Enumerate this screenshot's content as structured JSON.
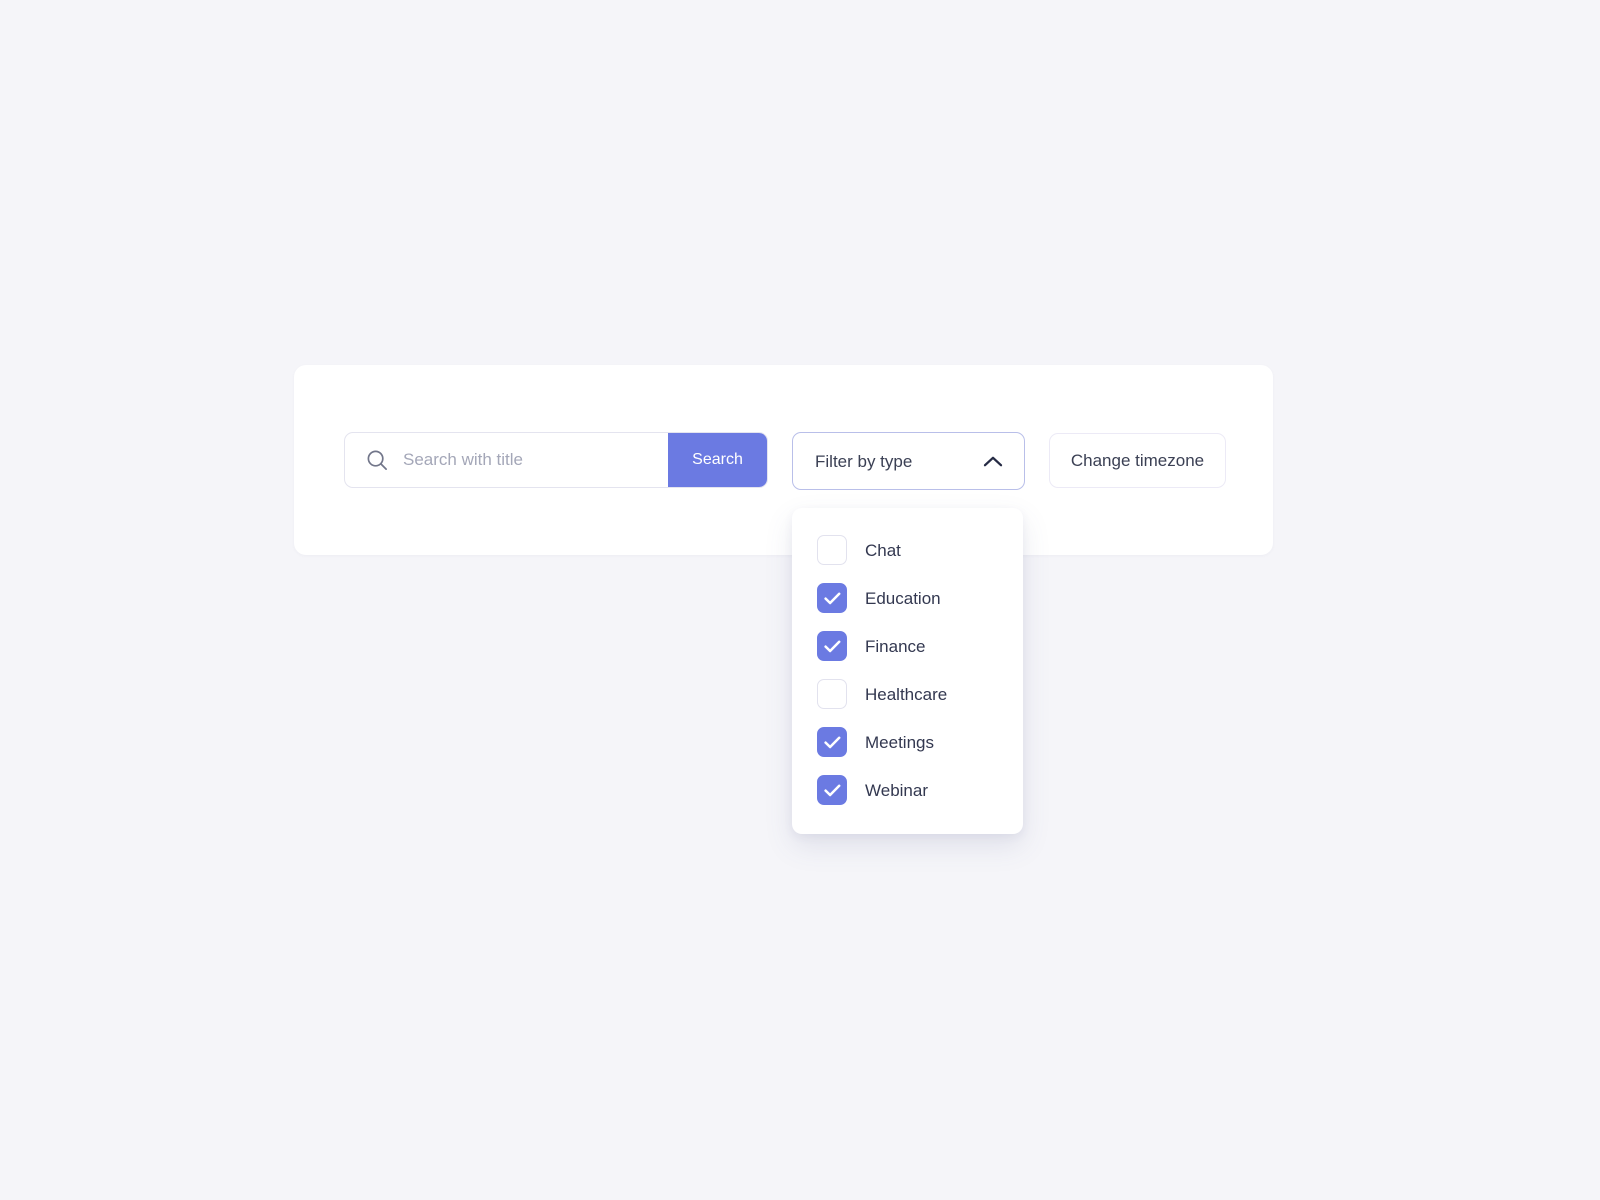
{
  "search": {
    "icon": "search-icon",
    "value": "",
    "placeholder": "Search with title",
    "button_label": "Search"
  },
  "filter": {
    "label": "Filter by type",
    "chevron_icon": "chevron-up-icon",
    "expanded": true,
    "options": [
      {
        "label": "Chat",
        "checked": false
      },
      {
        "label": "Education",
        "checked": true
      },
      {
        "label": "Finance",
        "checked": true
      },
      {
        "label": "Healthcare",
        "checked": false
      },
      {
        "label": "Meetings",
        "checked": true
      },
      {
        "label": "Webinar",
        "checked": true
      }
    ]
  },
  "timezone": {
    "label": "Change timezone"
  },
  "colors": {
    "accent": "#6b7ae2",
    "page_background": "#f5f5f9",
    "card_background": "#ffffff",
    "text_primary": "#333850",
    "placeholder": "#a4a7b8",
    "filter_border": "#b9bfe9",
    "input_border": "#e4e4ef"
  }
}
